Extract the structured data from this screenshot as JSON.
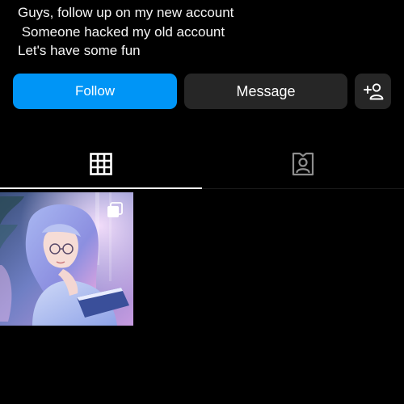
{
  "profile": {
    "bio_lines": [
      "Guys, follow up on my new account",
      " Someone hacked my old account",
      "Let's have some fun"
    ]
  },
  "actions": {
    "follow_label": "Follow",
    "message_label": "Message",
    "add_user_icon": "add-user-icon"
  },
  "tabs": [
    {
      "name": "posts-grid",
      "icon": "grid-icon",
      "active": true
    },
    {
      "name": "tagged",
      "icon": "tagged-person-icon",
      "active": false
    }
  ],
  "posts": [
    {
      "type": "multi-image",
      "alt_icon": "multiple-images-icon"
    }
  ],
  "colors": {
    "background": "#000000",
    "accent": "#0095f6",
    "secondary_button": "#262626",
    "text": "#ffffff"
  }
}
